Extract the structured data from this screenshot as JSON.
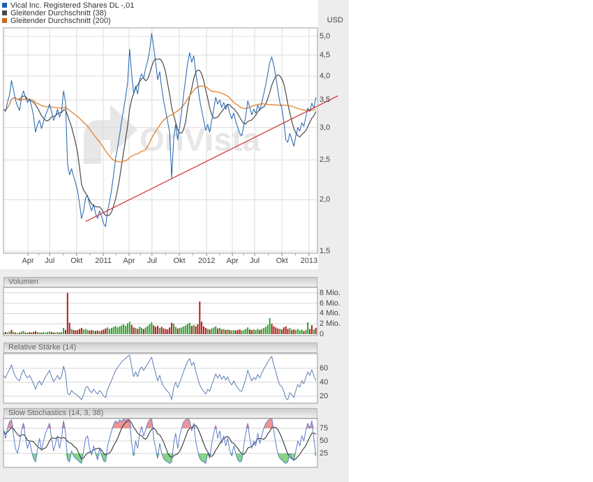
{
  "widget": {
    "unit_label": "USD",
    "background": "#ededed",
    "watermark": "OnVista",
    "legend": [
      {
        "label": "Vical Inc. Registered Shares DL -,01",
        "color": "#1a5fae"
      },
      {
        "label": "Gleitender Durchschnitt (38)",
        "color": "#4a4a4a"
      },
      {
        "label": "Gleitender Durchschnitt (200)",
        "color": "#c96a1f"
      }
    ]
  },
  "panels": {
    "volume": {
      "title": "Volumen"
    },
    "rsi": {
      "title": "Relative Stärke (14)"
    },
    "stochastic": {
      "title": "Slow Stochastics (14, 3, 38)"
    }
  },
  "chart_data": {
    "type": "line",
    "x_axis": {
      "ticks": [
        {
          "label": "Apr",
          "pos": 0.078
        },
        {
          "label": "Jul",
          "pos": 0.147
        },
        {
          "label": "Okt",
          "pos": 0.233
        },
        {
          "label": "2011",
          "pos": 0.318
        },
        {
          "label": "Apr",
          "pos": 0.4
        },
        {
          "label": "Jul",
          "pos": 0.473
        },
        {
          "label": "Okt",
          "pos": 0.56
        },
        {
          "label": "2012",
          "pos": 0.647
        },
        {
          "label": "Apr",
          "pos": 0.729
        },
        {
          "label": "Jul",
          "pos": 0.8
        },
        {
          "label": "Okt",
          "pos": 0.887
        },
        {
          "label": "2013",
          "pos": 0.973
        }
      ]
    },
    "price_panel": {
      "scale": "log",
      "unit_label": "USD",
      "ylim": [
        1.48,
        5.26
      ],
      "y_ticks": [
        {
          "label": "5,0",
          "value": 5.0
        },
        {
          "label": "4,5",
          "value": 4.5
        },
        {
          "label": "4,0",
          "value": 4.0
        },
        {
          "label": "3,5",
          "value": 3.5
        },
        {
          "label": "3,0",
          "value": 3.0
        },
        {
          "label": "2,5",
          "value": 2.5
        },
        {
          "label": "2,0",
          "value": 2.0
        },
        {
          "label": "1,5",
          "value": 1.5
        }
      ],
      "series": [
        {
          "name": "Vical Inc. Registered Shares DL -,01",
          "kind": "price",
          "color": "#1e62ae",
          "values": [
            3.32,
            3.28,
            3.45,
            3.6,
            3.9,
            3.7,
            3.5,
            3.38,
            3.3,
            3.55,
            3.68,
            3.55,
            3.45,
            3.52,
            3.38,
            3.2,
            2.92,
            3.05,
            3.12,
            2.98,
            3.1,
            3.22,
            3.3,
            3.42,
            3.28,
            3.12,
            3.2,
            3.32,
            3.18,
            3.28,
            3.68,
            3.45,
            2.45,
            2.3,
            2.38,
            2.28,
            2.2,
            2.1,
            1.95,
            1.8,
            1.88,
            2.02,
            2.05,
            1.95,
            1.88,
            1.95,
            1.85,
            1.8,
            1.88,
            1.82,
            1.75,
            1.72,
            1.88,
            1.98,
            2.12,
            2.3,
            2.52,
            2.68,
            2.88,
            3.1,
            3.32,
            3.55,
            3.85,
            4.65,
            4.05,
            3.62,
            3.78,
            3.62,
            3.92,
            4.05,
            3.95,
            4.18,
            4.35,
            4.62,
            5.08,
            4.7,
            4.32,
            3.92,
            4.1,
            3.75,
            3.48,
            3.28,
            3.1,
            2.92,
            2.26,
            2.82,
            3.05,
            2.8,
            3.02,
            3.28,
            3.62,
            3.95,
            4.3,
            4.56,
            4.32,
            4.48,
            4.1,
            3.8,
            3.5,
            3.3,
            3.12,
            2.95,
            3.05,
            2.92,
            3.12,
            3.32,
            3.55,
            3.42,
            3.5,
            3.35,
            3.45,
            3.32,
            3.42,
            3.25,
            3.15,
            3.25,
            3.1,
            3.0,
            2.9,
            2.86,
            3.02,
            3.2,
            3.48,
            3.35,
            3.22,
            3.32,
            3.25,
            3.4,
            3.3,
            3.45,
            3.62,
            3.82,
            4.05,
            4.32,
            4.45,
            4.25,
            4.0,
            3.7,
            3.45,
            3.35,
            3.1,
            2.8,
            2.76,
            2.9,
            2.8,
            2.7,
            2.86,
            3.0,
            2.94,
            3.08,
            3.02,
            3.18,
            3.34,
            3.28,
            3.44,
            3.34,
            3.55
          ]
        },
        {
          "name": "Gleitender Durchschnitt (38)",
          "kind": "sma",
          "window": 8,
          "color": "#4a4a4a"
        },
        {
          "name": "Gleitender Durchschnitt (200)",
          "kind": "sma",
          "window": 40,
          "color": "#e0812c"
        }
      ],
      "trendline": {
        "color": "#d32f2f",
        "start": {
          "i": 41,
          "price": 1.77
        },
        "end": {
          "i": 167,
          "price": 3.58
        }
      }
    },
    "volume_panel": {
      "unit": "Mio.",
      "y_ticks": [
        {
          "label": "8 Mio.",
          "value": 8
        },
        {
          "label": "6 Mio.",
          "value": 6
        },
        {
          "label": "4 Mio.",
          "value": 4
        },
        {
          "label": "2 Mio.",
          "value": 2
        },
        {
          "label": "0",
          "value": 0
        }
      ],
      "up_color": "#2ea12e",
      "down_color": "#b01c1c",
      "colors": "grggrgrgrggrgrrrrggrggggrrggrggrrrgrrrrrgggrrgrrgrrrggggggggggggrrgrggrggggrrrgrrrrrrggrggggggrgrrrrrrgrgggrgrgrgrggrrrggggrrgggrgggggrrrrgrrrrgrrggggrggrrgr",
      "values": [
        0.3,
        0.4,
        0.3,
        0.5,
        0.8,
        0.4,
        0.3,
        0.2,
        0.3,
        0.5,
        0.6,
        0.3,
        0.3,
        0.4,
        0.3,
        0.4,
        0.6,
        0.4,
        0.3,
        0.3,
        0.4,
        0.3,
        0.4,
        0.5,
        0.4,
        0.3,
        0.3,
        0.4,
        0.3,
        0.4,
        1.2,
        0.8,
        8.0,
        2.2,
        1.0,
        0.8,
        0.7,
        0.8,
        1.0,
        1.2,
        0.9,
        1.0,
        0.8,
        0.7,
        0.8,
        0.7,
        0.6,
        0.7,
        0.6,
        0.7,
        0.9,
        1.1,
        1.3,
        1.0,
        1.2,
        1.4,
        1.6,
        1.3,
        1.5,
        1.7,
        1.9,
        1.6,
        2.1,
        2.4,
        1.8,
        1.3,
        1.2,
        1.0,
        1.4,
        1.2,
        1.0,
        1.3,
        1.6,
        1.9,
        2.3,
        1.7,
        1.4,
        1.6,
        1.2,
        1.4,
        1.1,
        1.0,
        0.9,
        1.3,
        2.2,
        2.0,
        1.4,
        1.1,
        1.2,
        1.3,
        1.5,
        1.7,
        2.0,
        2.2,
        1.6,
        1.8,
        1.5,
        1.9,
        6.3,
        2.4,
        1.5,
        1.2,
        1.0,
        0.9,
        1.1,
        1.3,
        1.5,
        1.1,
        1.2,
        0.9,
        1.0,
        0.8,
        0.9,
        0.8,
        0.7,
        0.8,
        0.7,
        0.8,
        0.9,
        0.7,
        0.8,
        1.0,
        1.3,
        0.9,
        0.8,
        0.9,
        0.8,
        1.0,
        0.8,
        1.0,
        1.2,
        1.4,
        1.8,
        3.1,
        2.0,
        1.5,
        1.3,
        1.1,
        1.0,
        0.9,
        1.3,
        1.5,
        1.0,
        1.2,
        0.8,
        0.9,
        0.8,
        1.0,
        0.7,
        0.9,
        0.6,
        0.8,
        2.3,
        1.0,
        1.7,
        0.9,
        1.2
      ]
    },
    "rsi_panel": {
      "color": "#5b7db1",
      "y_ticks": [
        {
          "label": "60",
          "value": 60
        },
        {
          "label": "40",
          "value": 40
        },
        {
          "label": "20",
          "value": 20
        }
      ],
      "values": [
        50,
        46,
        53,
        58,
        65,
        55,
        48,
        44,
        42,
        52,
        58,
        50,
        46,
        50,
        44,
        38,
        30,
        38,
        42,
        36,
        42,
        48,
        52,
        57,
        48,
        41,
        45,
        50,
        44,
        49,
        63,
        52,
        25,
        22,
        28,
        25,
        23,
        21,
        18,
        15,
        22,
        32,
        34,
        28,
        25,
        30,
        26,
        23,
        28,
        25,
        20,
        18,
        30,
        36,
        43,
        50,
        57,
        61,
        65,
        69,
        72,
        74,
        77,
        79,
        62,
        48,
        55,
        48,
        58,
        62,
        57,
        62,
        66,
        71,
        76,
        63,
        53,
        42,
        50,
        40,
        34,
        30,
        27,
        23,
        15,
        32,
        40,
        32,
        40,
        47,
        56,
        63,
        70,
        74,
        64,
        69,
        56,
        46,
        36,
        31,
        27,
        23,
        30,
        27,
        36,
        44,
        52,
        46,
        51,
        44,
        49,
        43,
        48,
        40,
        36,
        42,
        36,
        32,
        28,
        27,
        36,
        45,
        57,
        49,
        42,
        47,
        44,
        51,
        46,
        53,
        59,
        64,
        69,
        74,
        77,
        65,
        55,
        44,
        36,
        34,
        27,
        17,
        15,
        25,
        22,
        18,
        28,
        37,
        33,
        42,
        38,
        47,
        55,
        50,
        58,
        50,
        42
      ]
    },
    "stochastic_panel": {
      "fast_color": "#5a7dc8",
      "slow_color": "#333333",
      "slow_window": 8,
      "overbought_level": 75,
      "oversold_level": 25,
      "overbought_fill": "#ef9595",
      "oversold_fill": "#85d585",
      "y_ticks": [
        {
          "label": "75",
          "value": 75
        },
        {
          "label": "50",
          "value": 50
        },
        {
          "label": "25",
          "value": 25
        }
      ],
      "fast": [
        72,
        55,
        75,
        88,
        92,
        60,
        35,
        25,
        45,
        70,
        85,
        55,
        35,
        50,
        30,
        15,
        8,
        35,
        55,
        30,
        50,
        65,
        75,
        85,
        55,
        30,
        45,
        60,
        35,
        55,
        90,
        65,
        12,
        8,
        30,
        20,
        15,
        12,
        8,
        5,
        30,
        55,
        60,
        35,
        22,
        40,
        25,
        12,
        35,
        22,
        10,
        8,
        40,
        55,
        70,
        82,
        90,
        85,
        92,
        88,
        94,
        90,
        95,
        92,
        45,
        20,
        50,
        35,
        65,
        78,
        60,
        72,
        85,
        92,
        95,
        55,
        35,
        15,
        45,
        25,
        15,
        10,
        8,
        5,
        8,
        45,
        65,
        35,
        60,
        75,
        88,
        92,
        95,
        90,
        70,
        85,
        50,
        30,
        15,
        10,
        8,
        5,
        25,
        15,
        45,
        65,
        80,
        55,
        70,
        45,
        60,
        40,
        55,
        30,
        20,
        40,
        25,
        12,
        8,
        10,
        40,
        65,
        85,
        55,
        35,
        50,
        40,
        65,
        45,
        60,
        75,
        85,
        90,
        94,
        95,
        70,
        45,
        25,
        15,
        12,
        8,
        5,
        8,
        25,
        15,
        10,
        30,
        50,
        40,
        60,
        50,
        70,
        85,
        75,
        90,
        55,
        20
      ]
    }
  }
}
